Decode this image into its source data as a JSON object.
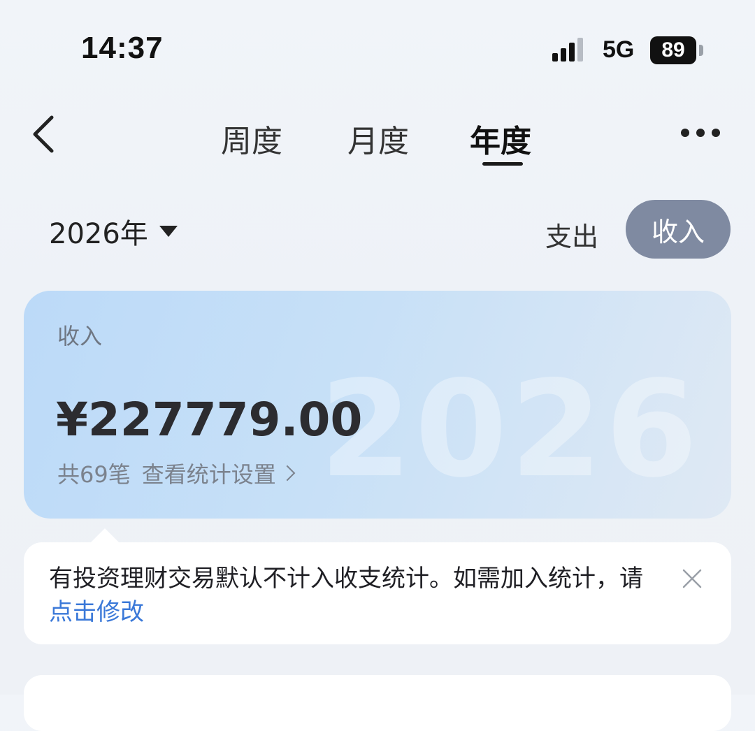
{
  "status_bar": {
    "time": "14:37",
    "network": "5G",
    "battery": "89"
  },
  "nav": {
    "back_icon": "chevron-left-icon",
    "tabs": [
      {
        "label": "周度"
      },
      {
        "label": "月度"
      },
      {
        "label": "年度",
        "active": true
      }
    ],
    "more_icon": "more-dots-icon"
  },
  "filter": {
    "year": "2026年",
    "toggle": {
      "expense": "支出",
      "income": "收入",
      "selected": "收入"
    }
  },
  "summary": {
    "label": "收入",
    "amount": "¥227779.00",
    "count": "共69笔",
    "settings_link": "查看统计设置",
    "watermark": "2026",
    "colors": {
      "card_start": "#bcdaf8",
      "card_end": "#dfe9f4"
    }
  },
  "tip": {
    "text": "有投资理财交易默认不计入收支统计。如需加入统计，请",
    "link": "点击修改",
    "link_color": "#3a78d8"
  },
  "colors": {
    "toggle_active": "#7f8aa1"
  }
}
